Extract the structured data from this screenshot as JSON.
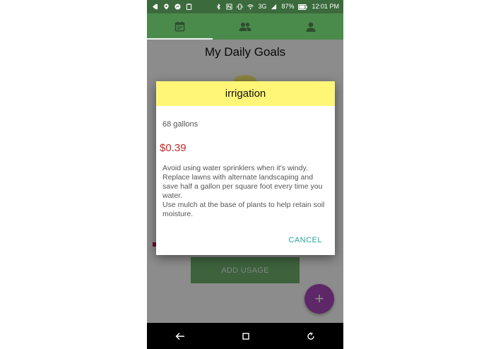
{
  "status_bar": {
    "left_icons": [
      "screenshot-icon",
      "location-icon",
      "messenger-icon",
      "clipboard-icon"
    ],
    "right_icons": [
      "bluetooth-icon",
      "nfc-icon",
      "vibrate-icon",
      "wifi-icon",
      "network-3g-icon",
      "signal-icon",
      "battery-icon"
    ],
    "network_label": "3G",
    "battery_percent": "87%",
    "time": "12:01",
    "time_suffix": "PM"
  },
  "tabs": [
    {
      "icon": "calendar-icon",
      "active": true
    },
    {
      "icon": "group-icon",
      "active": false
    },
    {
      "icon": "person-icon",
      "active": false
    }
  ],
  "page": {
    "title": "My Daily Goals",
    "add_usage_label": "ADD USAGE",
    "fab_label": "+"
  },
  "dialog": {
    "title": "irrigation",
    "amount": "68 gallons",
    "price": "$0.39",
    "tips": [
      "Avoid using water sprinklers when it's windy.",
      "Replace lawns with alternate landscaping and save half a gallon per square foot every time you water.",
      "Use mulch at the base of plants to help retain soil moisture."
    ],
    "cancel_label": "CANCEL"
  },
  "colors": {
    "status_bar": "#3b6a3c",
    "tab_bar": "#4a8a4b",
    "dialog_header": "#fff677",
    "price": "#c62828",
    "accent": "#26a69a",
    "fab": "#ab47bc"
  },
  "nav_bar": {
    "buttons": [
      "back-icon",
      "home-icon",
      "recents-icon"
    ]
  }
}
